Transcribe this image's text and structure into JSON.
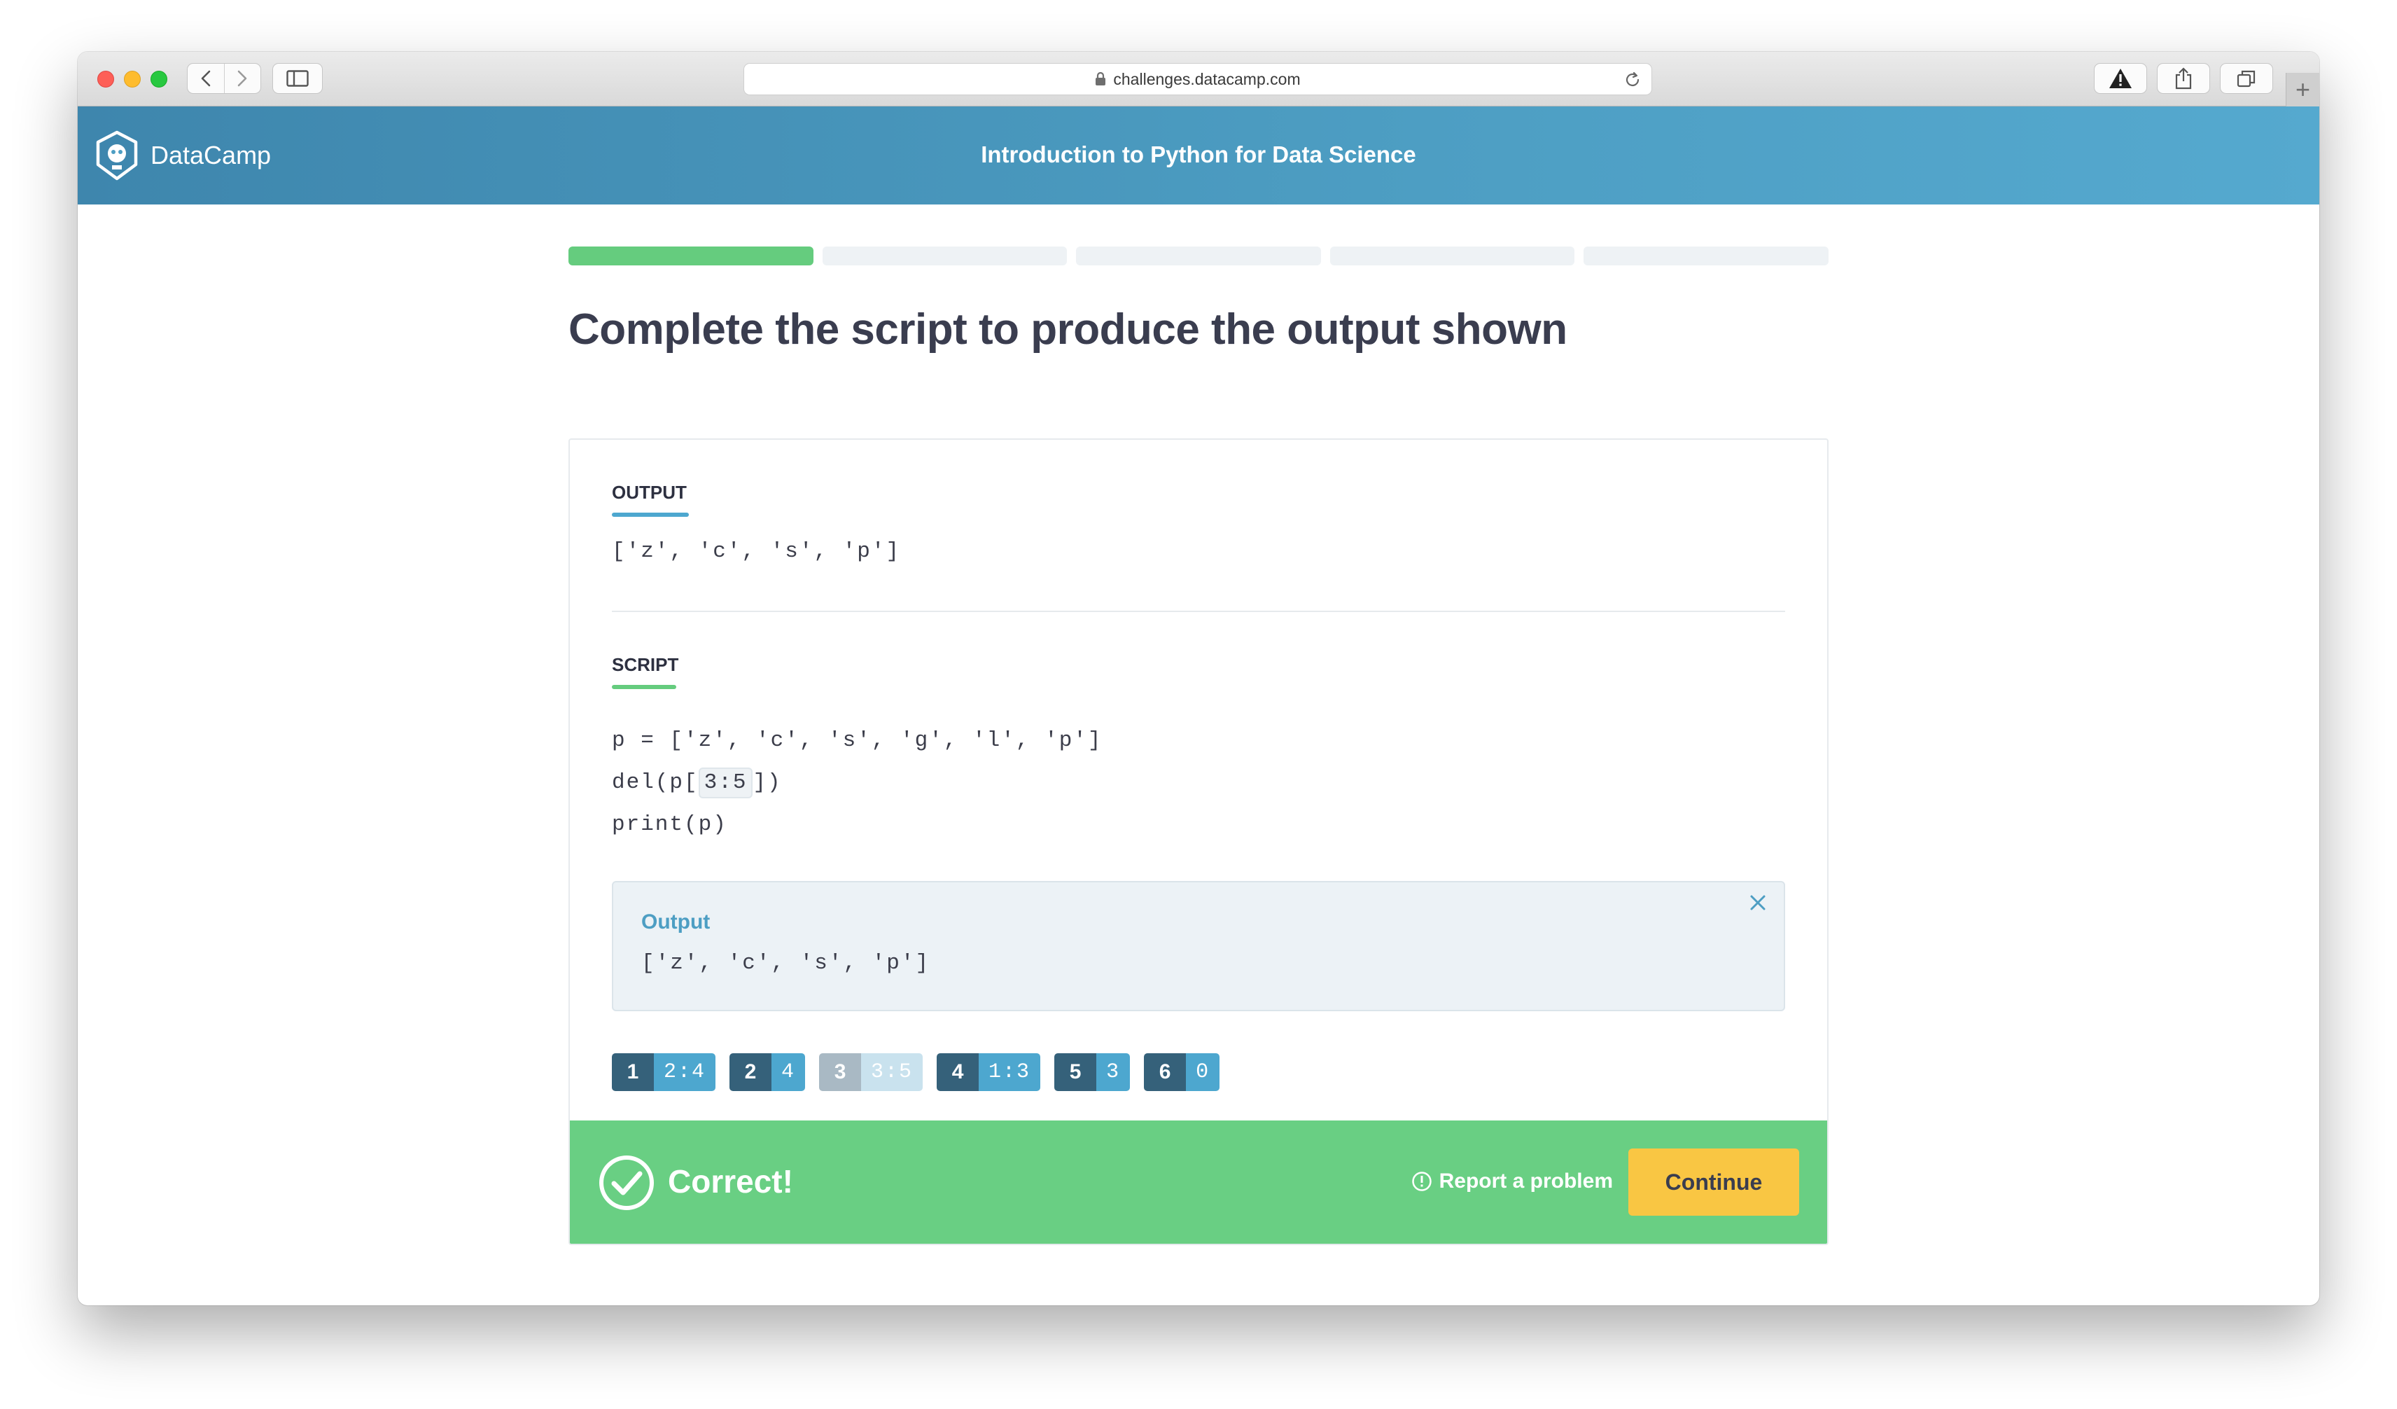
{
  "browser": {
    "url": "challenges.datacamp.com"
  },
  "header": {
    "brand": "DataCamp",
    "course_title": "Introduction to Python for Data Science"
  },
  "progress": {
    "total_segments": 5,
    "completed_segments": 1
  },
  "question": {
    "title": "Complete the script to produce the output shown"
  },
  "output_section": {
    "label": "OUTPUT",
    "text": "['z', 'c', 's', 'p']",
    "accent_color": "#4da7cf"
  },
  "script_section": {
    "label": "SCRIPT",
    "accent_color": "#65cc7e",
    "line1": "p = ['z', 'c', 's', 'g', 'l', 'p']",
    "line2_prefix": "del(p[",
    "line2_blank": "3:5",
    "line2_suffix": "])",
    "line3": "print(p)"
  },
  "result": {
    "label": "Output",
    "text": "['z', 'c', 's', 'p']"
  },
  "options": [
    {
      "num": "1",
      "value": "2:4",
      "used": false
    },
    {
      "num": "2",
      "value": "4",
      "used": false
    },
    {
      "num": "3",
      "value": "3:5",
      "used": true
    },
    {
      "num": "4",
      "value": "1:3",
      "used": false
    },
    {
      "num": "5",
      "value": "3",
      "used": false
    },
    {
      "num": "6",
      "value": "0",
      "used": false
    }
  ],
  "feedback": {
    "status": "Correct!",
    "report_label": "Report a problem",
    "continue_label": "Continue",
    "color": "#69cf83",
    "button_color": "#f9c643"
  }
}
